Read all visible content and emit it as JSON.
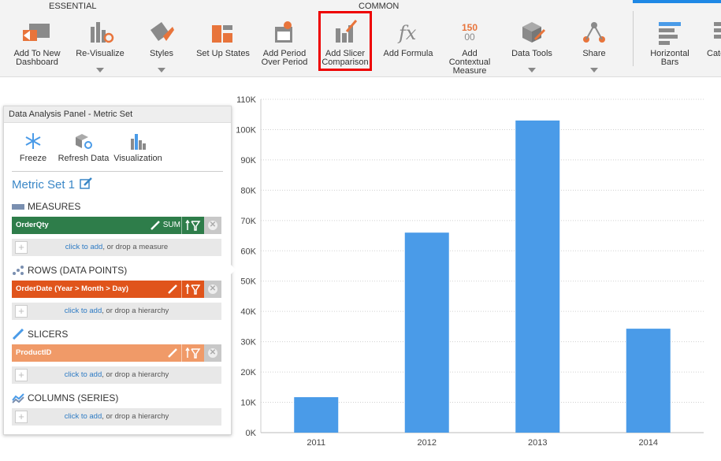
{
  "ribbon": {
    "groups": [
      "ESSENTIAL",
      "COMMON"
    ],
    "buttons": {
      "add_to_dashboard": [
        "Add To New",
        "Dashboard"
      ],
      "revisualize": "Re-Visualize",
      "styles": "Styles",
      "setup_states": "Set Up States",
      "add_period": [
        "Add Period",
        "Over Period"
      ],
      "add_slicer": [
        "Add Slicer",
        "Comparison"
      ],
      "add_formula": "Add Formula",
      "add_contextual": [
        "Add",
        "Contextual",
        "Measure"
      ],
      "contextual_icon_top": "150",
      "contextual_icon_bottom": "00",
      "data_tools": "Data Tools",
      "share": "Share",
      "horizontal_bars": [
        "Horizontal",
        "Bars"
      ],
      "category_partial": "Cate"
    },
    "colors": {
      "icon": "#8a8a8a",
      "accent": "#e8743b",
      "highlight": "#e00000"
    }
  },
  "panel": {
    "title": "Data Analysis Panel - Metric Set",
    "tools": [
      "Freeze",
      "Refresh Data",
      "Visualization"
    ],
    "metric_set": "Metric Set 1",
    "sections": {
      "measures": "MEASURES",
      "rows": "ROWS (DATA POINTS)",
      "slicers": "SLICERS",
      "columns": "COLUMNS (SERIES)"
    },
    "pills": {
      "measure": {
        "name": "OrderQty",
        "agg": "SUM",
        "color": "#2e7d4a"
      },
      "row": {
        "name": "OrderDate (Year > Month > Day)",
        "color": "#e0541b"
      },
      "slicer": {
        "name": "ProductID",
        "color": "#f09a68"
      }
    },
    "drop": {
      "link": "click to add",
      "measure_suffix": ", or drop a measure",
      "hierarchy_suffix": ", or drop a hierarchy"
    }
  },
  "chart_data": {
    "type": "bar",
    "categories": [
      "2011",
      "2012",
      "2013",
      "2014"
    ],
    "values": [
      11700,
      66000,
      103000,
      34300
    ],
    "ylim": [
      0,
      110000
    ],
    "yticks": [
      "0K",
      "10K",
      "20K",
      "30K",
      "40K",
      "50K",
      "60K",
      "70K",
      "80K",
      "90K",
      "100K",
      "110K"
    ],
    "bar_color": "#4a9be8",
    "grid": true
  }
}
